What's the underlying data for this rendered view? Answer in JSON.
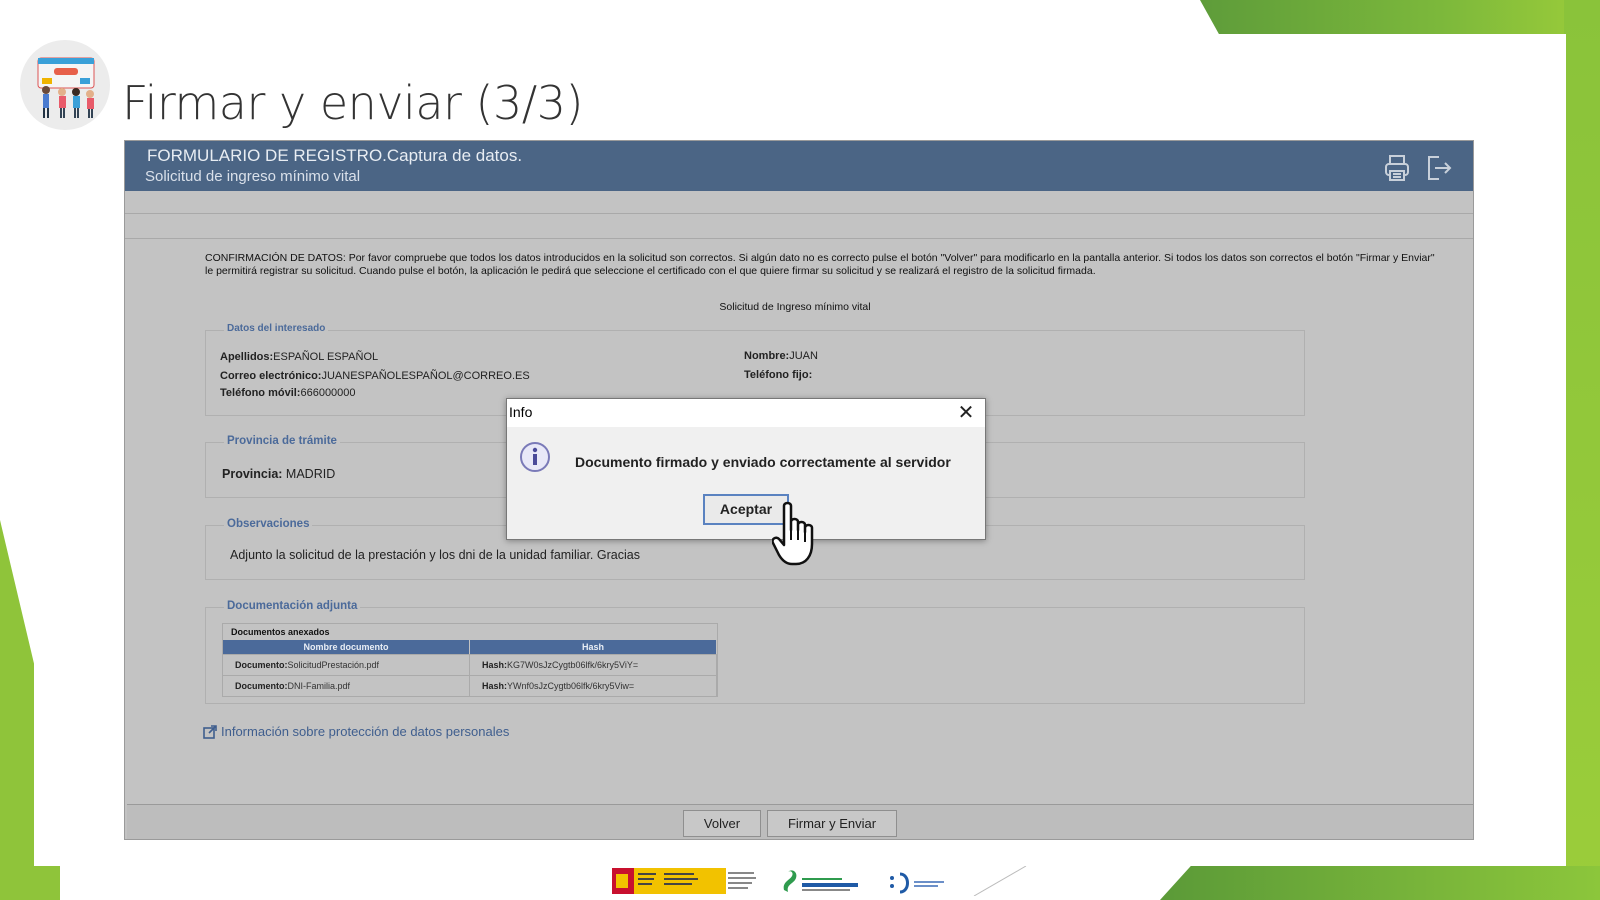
{
  "slide": {
    "title": "Firmar y enviar (3/3)"
  },
  "app": {
    "header_title": "FORMULARIO DE REGISTRO.Captura de datos.",
    "header_subtitle": "Solicitud de ingreso mínimo vital",
    "header_icons": [
      "printer-icon",
      "exit-icon"
    ],
    "confirmation_text": "CONFIRMACIÓN DE DATOS: Por favor compruebe que todos los datos introducidos en la solicitud son correctos. Si algún dato no es correcto pulse el botón \"Volver\" para modificarlo en la pantalla anterior. Si todos los datos son correctos el botón \"Firmar y Enviar\" le permitirá registrar su solicitud. Cuando pulse el botón, la aplicación le pedirá que seleccione el certificado con el que quiere firmar su solicitud y se realizará el registro de la solicitud firmada.",
    "form_heading": "Solicitud de Ingreso mínimo vital",
    "interesado": {
      "legend": "Datos del interesado",
      "apellidos_label": "Apellidos:",
      "apellidos_value": "ESPAÑOL ESPAÑOL",
      "correo_label": "Correo electrónico:",
      "correo_value": "JUANESPAÑOLESPAÑOL@CORREO.ES",
      "movil_label": "Teléfono móvil:",
      "movil_value": "666000000",
      "nombre_label": "Nombre:",
      "nombre_value": "JUAN",
      "fijo_label": "Teléfono fijo:"
    },
    "provincia": {
      "legend": "Provincia de trámite",
      "label": "Provincia:",
      "value": "MADRID"
    },
    "observaciones": {
      "legend": "Observaciones",
      "text": "Adjunto la solicitud de la prestación y los dni de la unidad familiar. Gracias"
    },
    "documentacion": {
      "legend": "Documentación adjunta",
      "caption": "Documentos anexados",
      "columns": [
        "Nombre documento",
        "Hash"
      ],
      "rows": [
        {
          "doc_label": "Documento:",
          "doc_value": "SolicitudPrestación.pdf",
          "hash_label": "Hash:",
          "hash_value": "KG7W0sJzCygtb06lfk/6kry5ViY="
        },
        {
          "doc_label": "Documento:",
          "doc_value": "DNI-Familia.pdf",
          "hash_label": "Hash:",
          "hash_value": "YWnf0sJzCygtb06lfk/6kry5Viw="
        }
      ]
    },
    "privacy_link": "Información sobre protección de datos personales",
    "footer": {
      "volver": "Volver",
      "firmar": "Firmar y Enviar"
    }
  },
  "dialog": {
    "title": "Info",
    "message": "Documento firmado y enviado correctamente al servidor",
    "ok_label": "Aceptar",
    "icon": "info-icon"
  },
  "colors": {
    "header_bg": "#4b6585",
    "legend_text": "#4b6a9a",
    "accent_green": "#8cc63b",
    "dialog_ok_border": "#5a82c0"
  }
}
